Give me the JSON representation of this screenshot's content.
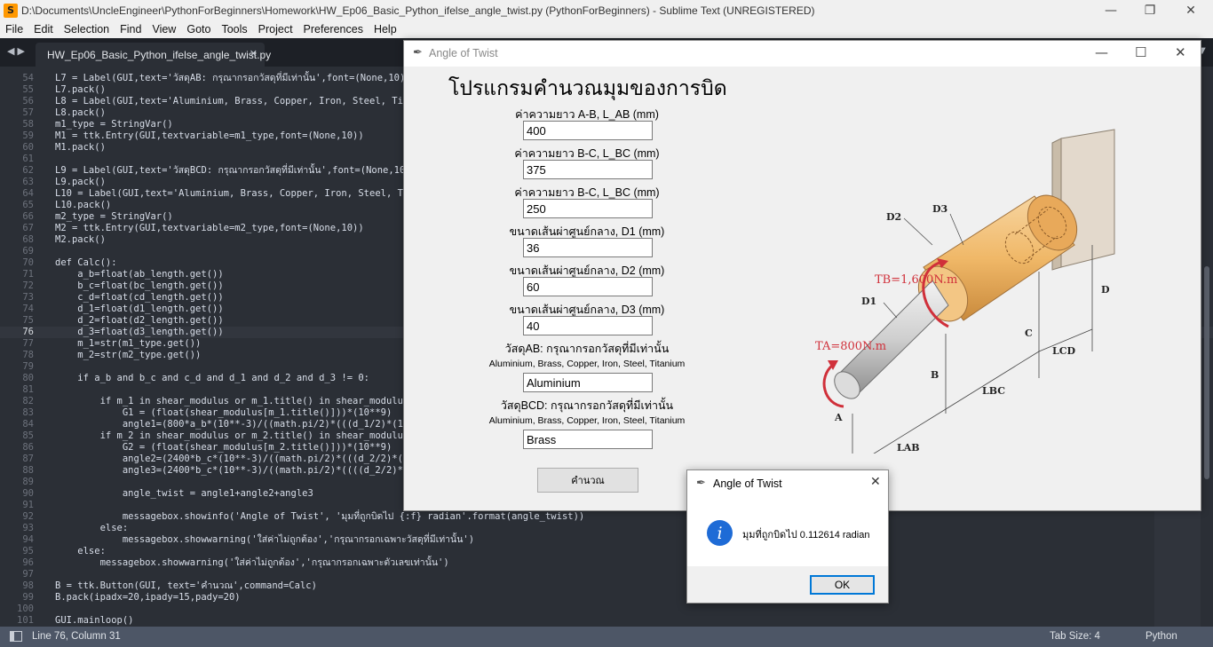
{
  "sublime": {
    "window_title": "D:\\Documents\\UncleEngineer\\PythonForBeginners\\Homework\\HW_Ep06_Basic_Python_ifelse_angle_twist.py (PythonForBeginners) - Sublime Text (UNREGISTERED)",
    "menu": [
      "File",
      "Edit",
      "Selection",
      "Find",
      "View",
      "Goto",
      "Tools",
      "Project",
      "Preferences",
      "Help"
    ],
    "tab_label": "HW_Ep06_Basic_Python_ifelse_angle_twist.py",
    "status": {
      "position": "Line 76, Column 31",
      "tab_size": "Tab Size: 4",
      "syntax": "Python"
    },
    "active_line": "76",
    "code": [
      {
        "n": "54",
        "text": "L7 = Label(GUI,text='วัสดุAB: กรุณากรอกวัสดุที่มีเท่านั้น',font=(None,10))"
      },
      {
        "n": "55",
        "text": "L7.pack()"
      },
      {
        "n": "56",
        "text": "L8 = Label(GUI,text='Aluminium, Brass, Copper, Iron, Steel, Titan"
      },
      {
        "n": "57",
        "text": "L8.pack()"
      },
      {
        "n": "58",
        "text": "m1_type = StringVar()"
      },
      {
        "n": "59",
        "text": "M1 = ttk.Entry(GUI,textvariable=m1_type,font=(None,10))"
      },
      {
        "n": "60",
        "text": "M1.pack()"
      },
      {
        "n": "61",
        "text": ""
      },
      {
        "n": "62",
        "text": "L9 = Label(GUI,text='วัสดุBCD: กรุณากรอกวัสดุที่มีเท่านั้น',font=(None,10))"
      },
      {
        "n": "63",
        "text": "L9.pack()"
      },
      {
        "n": "64",
        "text": "L10 = Label(GUI,text='Aluminium, Brass, Copper, Iron, Steel, Tita"
      },
      {
        "n": "65",
        "text": "L10.pack()"
      },
      {
        "n": "66",
        "text": "m2_type = StringVar()"
      },
      {
        "n": "67",
        "text": "M2 = ttk.Entry(GUI,textvariable=m2_type,font=(None,10))"
      },
      {
        "n": "68",
        "text": "M2.pack()"
      },
      {
        "n": "69",
        "text": ""
      },
      {
        "n": "70",
        "text": "def Calc():"
      },
      {
        "n": "71",
        "text": "    a_b=float(ab_length.get())"
      },
      {
        "n": "72",
        "text": "    b_c=float(bc_length.get())"
      },
      {
        "n": "73",
        "text": "    c_d=float(cd_length.get())"
      },
      {
        "n": "74",
        "text": "    d_1=float(d1_length.get())"
      },
      {
        "n": "75",
        "text": "    d_2=float(d2_length.get())"
      },
      {
        "n": "76",
        "text": "    d_3=float(d3_length.get())"
      },
      {
        "n": "77",
        "text": "    m_1=str(m1_type.get())"
      },
      {
        "n": "78",
        "text": "    m_2=str(m2_type.get())"
      },
      {
        "n": "79",
        "text": ""
      },
      {
        "n": "80",
        "text": "    if a_b and b_c and c_d and d_1 and d_2 and d_3 != 0:"
      },
      {
        "n": "81",
        "text": ""
      },
      {
        "n": "82",
        "text": "        if m_1 in shear_modulus or m_1.title() in shear_modulus:"
      },
      {
        "n": "83",
        "text": "            G1 = (float(shear_modulus[m_1.title()]))*(10**9)"
      },
      {
        "n": "84",
        "text": "            angle1=(800*a_b*(10**-3)/((math.pi/2)*(((d_1/2)*(10**"
      },
      {
        "n": "85",
        "text": "        if m_2 in shear_modulus or m_2.title() in shear_modulus:"
      },
      {
        "n": "86",
        "text": "            G2 = (float(shear_modulus[m_2.title()]))*(10**9)"
      },
      {
        "n": "87",
        "text": "            angle2=(2400*b_c*(10**-3)/((math.pi/2)*(((d_2/2)*(10*"
      },
      {
        "n": "88",
        "text": "            angle3=(2400*b_c*(10**-3)/((math.pi/2)*((((d_2/2)*(10"
      },
      {
        "n": "89",
        "text": ""
      },
      {
        "n": "90",
        "text": "            angle_twist = angle1+angle2+angle3"
      },
      {
        "n": "91",
        "text": ""
      },
      {
        "n": "92",
        "text": "            messagebox.showinfo('Angle of Twist', 'มุมที่ถูกบิดไป {:f} radian'.format(angle_twist))"
      },
      {
        "n": "93",
        "text": "        else:"
      },
      {
        "n": "94",
        "text": "            messagebox.showwarning('ใส่ค่าไม่ถูกต้อง','กรุณากรอกเฉพาะวัสดุที่มีเท่านั้น')"
      },
      {
        "n": "95",
        "text": "    else:"
      },
      {
        "n": "96",
        "text": "        messagebox.showwarning('ใส่ค่าไม่ถูกต้อง','กรุณากรอกเฉพาะตัวเลขเท่านั้น')"
      },
      {
        "n": "97",
        "text": ""
      },
      {
        "n": "98",
        "text": "B = ttk.Button(GUI, text='คำนวณ',command=Calc)"
      },
      {
        "n": "99",
        "text": "B.pack(ipadx=20,ipady=15,pady=20)"
      },
      {
        "n": "100",
        "text": ""
      },
      {
        "n": "101",
        "text": "GUI.mainloop()"
      }
    ]
  },
  "tk_app": {
    "window_title": "Angle of Twist",
    "heading": "โปรแกรมคำนวณมุมของการบิด",
    "fields": [
      {
        "label": "ค่าความยาว A-B, L_AB (mm)",
        "value": "400"
      },
      {
        "label": "ค่าความยาว B-C, L_BC (mm)",
        "value": "375"
      },
      {
        "label": "ค่าความยาว B-C, L_BC (mm)",
        "value": "250"
      },
      {
        "label": "ขนาดเส้นผ่าศูนย์กลาง, D1 (mm)",
        "value": "36"
      },
      {
        "label": "ขนาดเส้นผ่าศูนย์กลาง, D2 (mm)",
        "value": "60"
      },
      {
        "label": "ขนาดเส้นผ่าศูนย์กลาง, D3 (mm)",
        "value": "40"
      }
    ],
    "material_ab_label": "วัสดุAB: กรุณากรอกวัสดุที่มีเท่านั้น",
    "material_options": "Aluminium, Brass, Copper, Iron, Steel, Titanium",
    "material_ab_value": "Aluminium",
    "material_bcd_label": "วัสดุBCD: กรุณากรอกวัสดุที่มีเท่านั้น",
    "material_bcd_value": "Brass",
    "calc_button": "คำนวณ",
    "figure": {
      "tb_label": "TB=1,600N.m",
      "ta_label": "TA=800N.m",
      "d1": "D1",
      "d2": "D2",
      "d3": "D3",
      "a": "A",
      "b": "B",
      "c": "C",
      "d": "D",
      "lab": "LAB",
      "lbc": "LBC",
      "lcd": "LCD"
    }
  },
  "messagebox": {
    "title": "Angle of Twist",
    "message": "มุมที่ถูกบิดไป 0.112614 radian",
    "ok": "OK"
  }
}
